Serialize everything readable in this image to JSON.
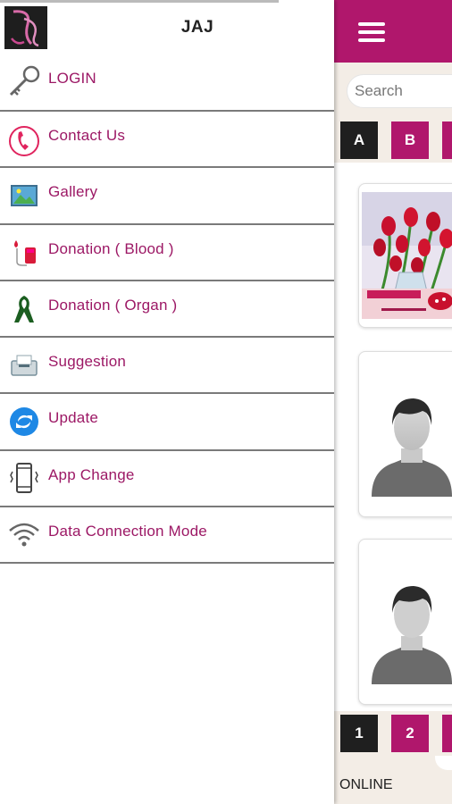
{
  "drawer": {
    "app_name": "JAJ",
    "menu": [
      {
        "label": "LOGIN",
        "icon": "key-icon"
      },
      {
        "label": "Contact Us",
        "icon": "phone-icon"
      },
      {
        "label": "Gallery",
        "icon": "image-gallery-icon"
      },
      {
        "label": "Donation ( Blood )",
        "icon": "blood-donation-icon"
      },
      {
        "label": "Donation ( Organ )",
        "icon": "ribbon-icon"
      },
      {
        "label": "Suggestion",
        "icon": "suggestion-box-icon"
      },
      {
        "label": "Update",
        "icon": "refresh-icon"
      },
      {
        "label": "App Change",
        "icon": "phone-vibrate-icon"
      },
      {
        "label": "Data Connection Mode",
        "icon": "wifi-icon"
      }
    ]
  },
  "background_app": {
    "search_placeholder": "Search",
    "letters": [
      "A",
      "B",
      ""
    ],
    "pages": [
      "1",
      "2",
      ""
    ],
    "status": "ONLINE"
  },
  "colors": {
    "brand": "#b0176c",
    "menu_text": "#9c1865",
    "dark_button": "#1f1f1f"
  }
}
